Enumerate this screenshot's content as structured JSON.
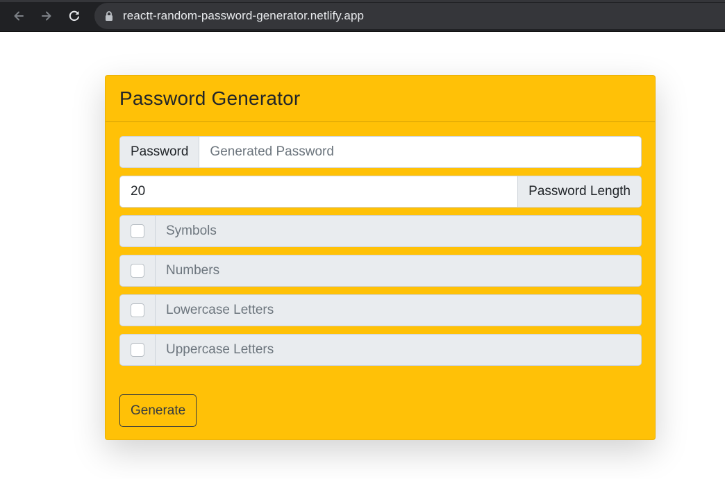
{
  "browser": {
    "url": "reactt-random-password-generator.netlify.app"
  },
  "card": {
    "title": "Password Generator"
  },
  "password": {
    "label": "Password",
    "placeholder": "Generated Password",
    "value": ""
  },
  "length": {
    "value": "20",
    "label": "Password Length"
  },
  "options": [
    {
      "label": "Symbols",
      "checked": false
    },
    {
      "label": "Numbers",
      "checked": false
    },
    {
      "label": "Lowercase Letters",
      "checked": false
    },
    {
      "label": "Uppercase Letters",
      "checked": false
    }
  ],
  "actions": {
    "generate_label": "Generate"
  },
  "colors": {
    "card_background": "#ffc107",
    "addon_background": "#e9ecef",
    "browser_chrome": "#202124"
  }
}
